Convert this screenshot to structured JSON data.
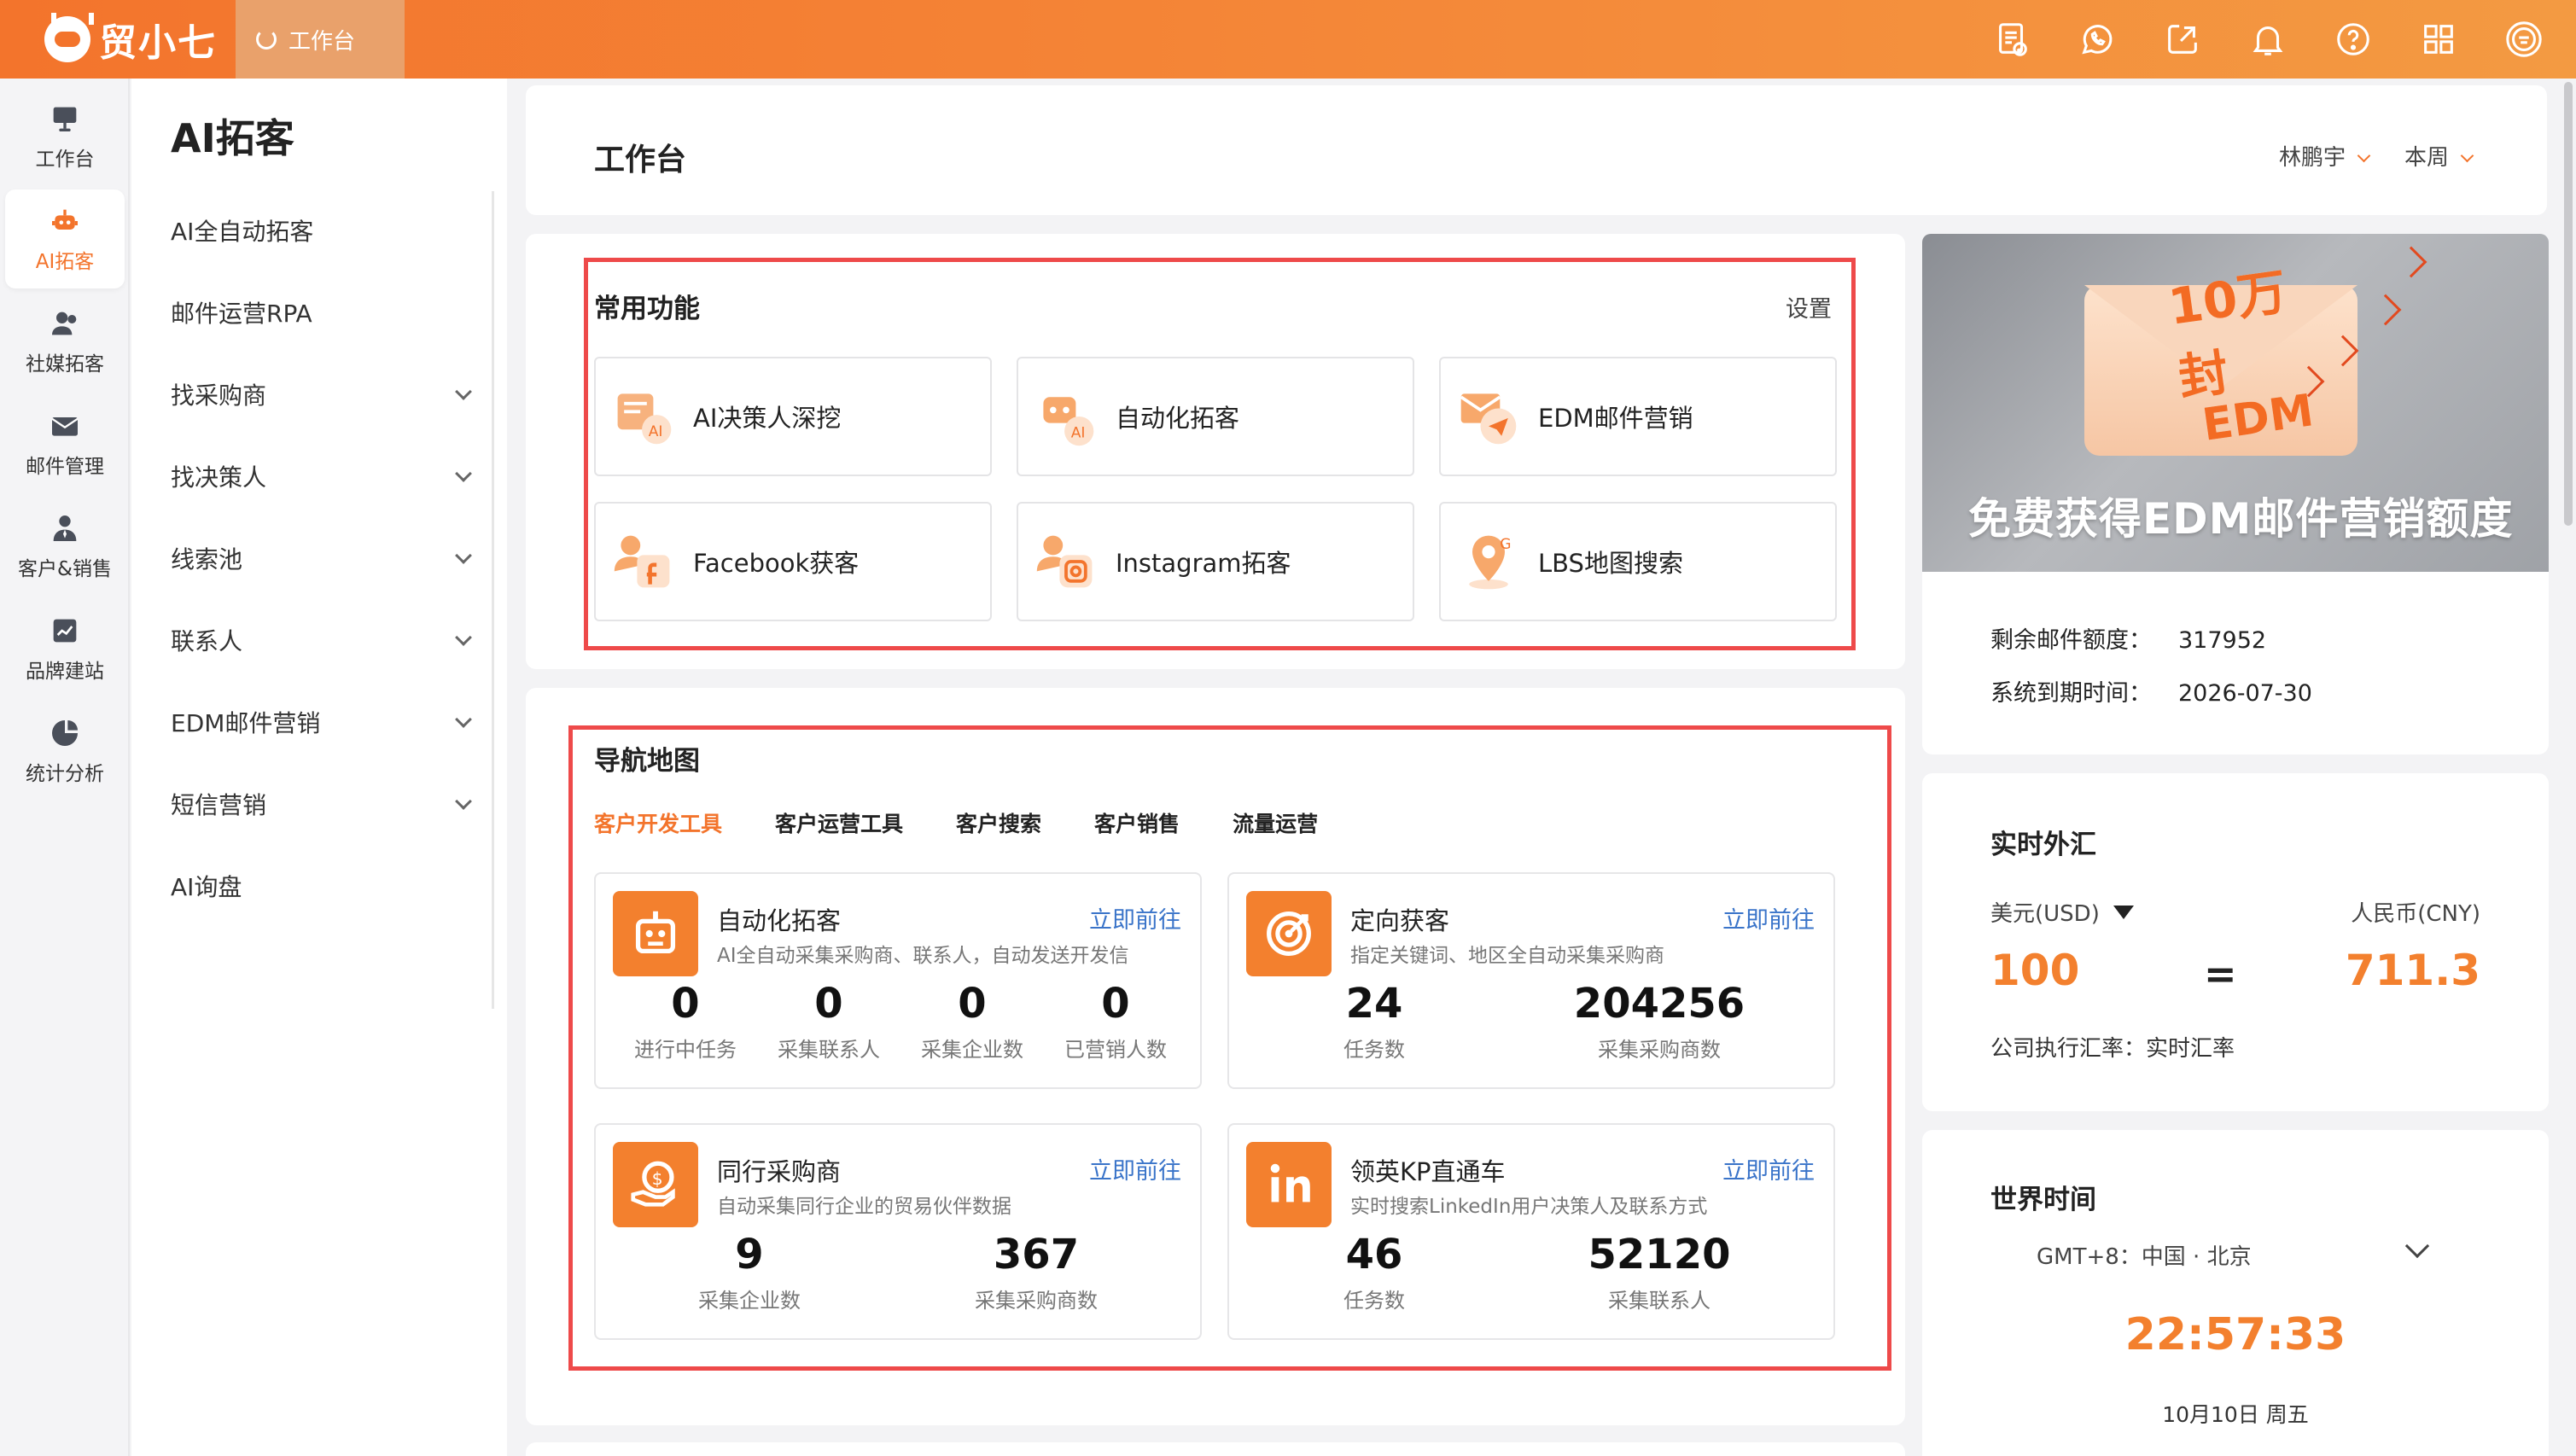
{
  "app": {
    "name": "贸小七",
    "open_tab": "工作台"
  },
  "colors": {
    "brand": "#f3742c",
    "link": "#3a74c9",
    "highlight_box": "#ee4a4a"
  },
  "top_icons": [
    "document-check-icon",
    "whatsapp-icon",
    "share-icon",
    "bell-icon",
    "help-icon",
    "apps-grid-icon",
    "user-avatar-icon"
  ],
  "rail": [
    {
      "label": "工作台",
      "icon": "monitor-icon"
    },
    {
      "label": "AI拓客",
      "icon": "robot-icon",
      "active": true
    },
    {
      "label": "社媒拓客",
      "icon": "users-icon"
    },
    {
      "label": "邮件管理",
      "icon": "mail-icon"
    },
    {
      "label": "客户&销售",
      "icon": "person-tie-icon"
    },
    {
      "label": "品牌建站",
      "icon": "chart-window-icon"
    },
    {
      "label": "统计分析",
      "icon": "pie-icon"
    }
  ],
  "sidenav": {
    "title": "AI拓客",
    "items": [
      {
        "label": "AI全自动拓客",
        "expandable": false
      },
      {
        "label": "邮件运营RPA",
        "expandable": false
      },
      {
        "label": "找采购商",
        "expandable": true
      },
      {
        "label": "找决策人",
        "expandable": true
      },
      {
        "label": "线索池",
        "expandable": true
      },
      {
        "label": "联系人",
        "expandable": true
      },
      {
        "label": "EDM邮件营销",
        "expandable": true
      },
      {
        "label": "短信营销",
        "expandable": true
      },
      {
        "label": "AI询盘",
        "expandable": false
      }
    ]
  },
  "workspace": {
    "title": "工作台",
    "user_filter": "林鹏宇",
    "period_filter": "本周"
  },
  "quick": {
    "title": "常用功能",
    "settings": "设置",
    "items": [
      "AI决策人深挖",
      "自动化拓客",
      "EDM邮件营销",
      "Facebook获客",
      "Instagram拓客",
      "LBS地图搜索"
    ]
  },
  "navmap": {
    "title": "导航地图",
    "tabs": [
      "客户开发工具",
      "客户运营工具",
      "客户搜索",
      "客户销售",
      "流量运营"
    ],
    "tools": [
      {
        "name": "自动化拓客",
        "go": "立即前往",
        "desc": "AI全自动采集采购商、联系人，自动发送开发信",
        "stats": [
          {
            "v": "0",
            "l": "进行中任务"
          },
          {
            "v": "0",
            "l": "采集联系人"
          },
          {
            "v": "0",
            "l": "采集企业数"
          },
          {
            "v": "0",
            "l": "已营销人数"
          }
        ]
      },
      {
        "name": "定向获客",
        "go": "立即前往",
        "desc": "指定关键词、地区全自动采集采购商",
        "stats": [
          {
            "v": "24",
            "l": "任务数"
          },
          {
            "v": "204256",
            "l": "采集采购商数"
          }
        ]
      },
      {
        "name": "同行采购商",
        "go": "立即前往",
        "desc": "自动采集同行企业的贸易伙伴数据",
        "stats": [
          {
            "v": "9",
            "l": "采集企业数"
          },
          {
            "v": "367",
            "l": "采集采购商数"
          }
        ]
      },
      {
        "name": "领英KP直通车",
        "go": "立即前往",
        "desc": "实时搜索LinkedIn用户决策人及联系方式",
        "stats": [
          {
            "v": "46",
            "l": "任务数"
          },
          {
            "v": "52120",
            "l": "采集联系人"
          }
        ]
      }
    ]
  },
  "banner": {
    "seal_line1": "10万封",
    "seal_line2": "EDM",
    "text": "免费获得EDM邮件营销额度"
  },
  "quota": {
    "remain_label": "剩余邮件额度：",
    "remain_value": "317952",
    "expire_label": "系统到期时间：",
    "expire_value": "2026-07-30"
  },
  "fx": {
    "title": "实时外汇",
    "from_label": "美元(USD)",
    "to_label": "人民币(CNY)",
    "from_value": "100",
    "equals": "=",
    "to_value": "711.3",
    "note": "公司执行汇率：实时汇率"
  },
  "world_time": {
    "title": "世界时间",
    "zone": "GMT+8：中国 · 北京",
    "time": "22:57:33",
    "date": "10月10日 周五"
  }
}
